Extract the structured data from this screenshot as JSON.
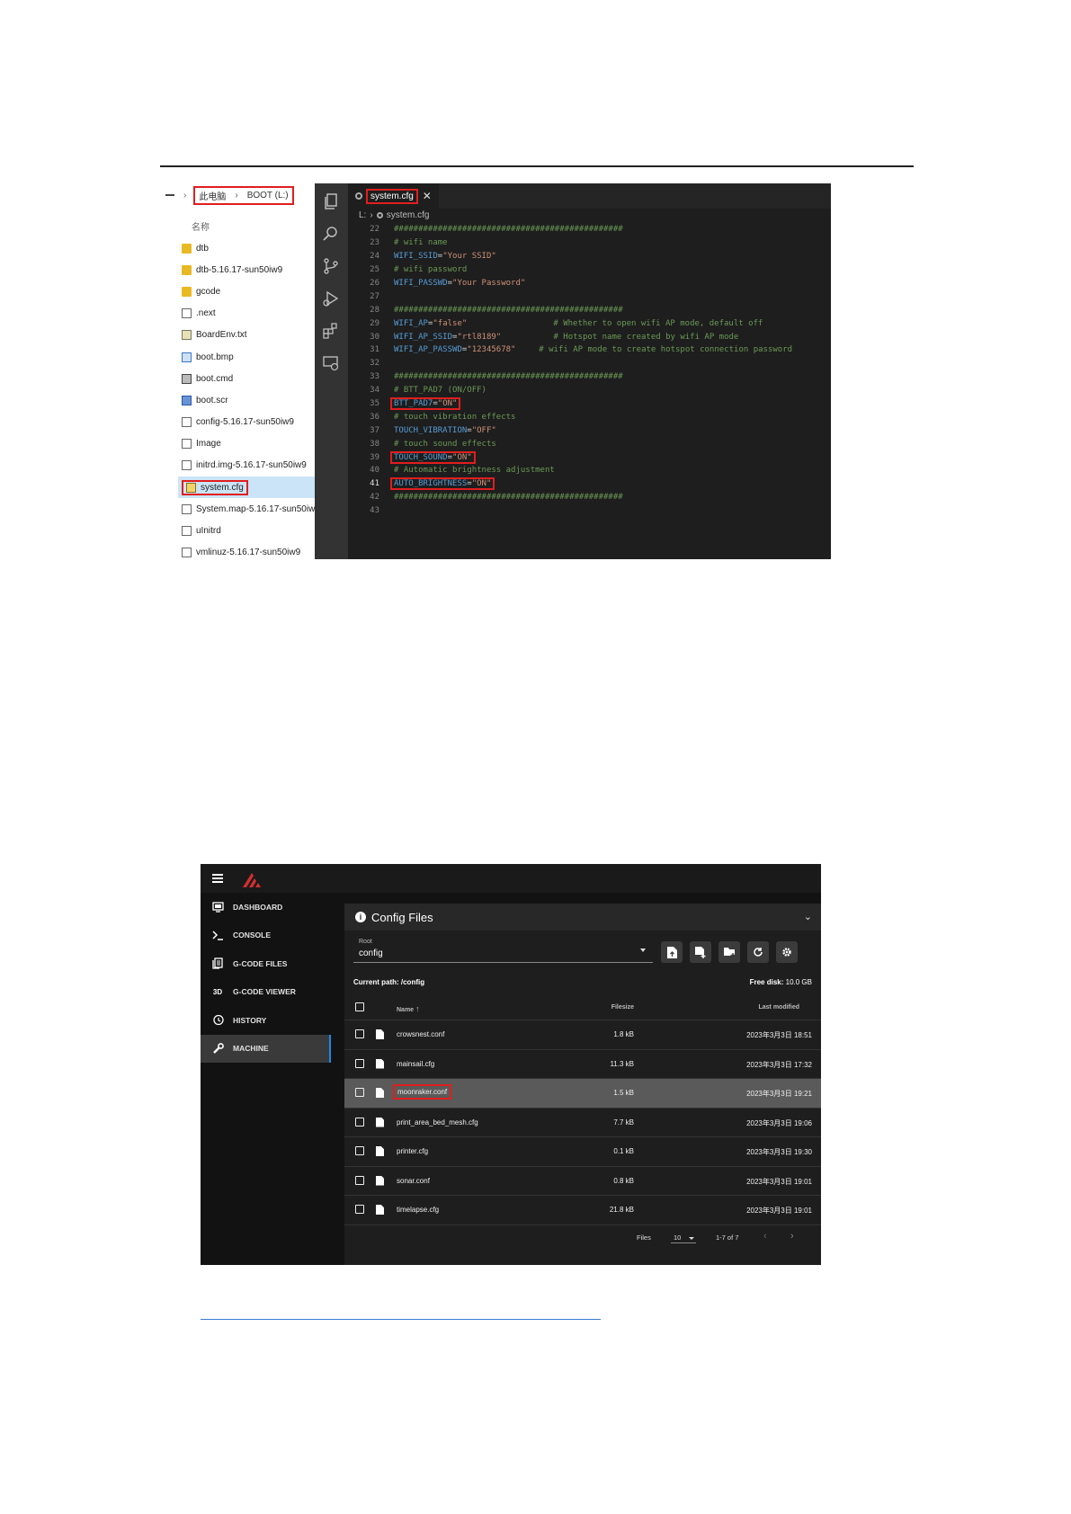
{
  "explorer": {
    "breadcrumb": [
      "此电脑",
      "BOOT (L:)"
    ],
    "column_header": "名称",
    "files": [
      {
        "name": "dtb",
        "icon": "folder-icon"
      },
      {
        "name": "dtb-5.16.17-sun50iw9",
        "icon": "folder-icon"
      },
      {
        "name": "gcode",
        "icon": "folder-icon"
      },
      {
        "name": ".next",
        "icon": "file-icon"
      },
      {
        "name": "BoardEnv.txt",
        "icon": "text-file-icon"
      },
      {
        "name": "boot.bmp",
        "icon": "image-file-icon"
      },
      {
        "name": "boot.cmd",
        "icon": "cmd-file-icon"
      },
      {
        "name": "boot.scr",
        "icon": "script-file-icon"
      },
      {
        "name": "config-5.16.17-sun50iw9",
        "icon": "file-icon"
      },
      {
        "name": "Image",
        "icon": "file-icon"
      },
      {
        "name": "initrd.img-5.16.17-sun50iw9",
        "icon": "file-icon"
      },
      {
        "name": "system.cfg",
        "icon": "config-file-icon"
      },
      {
        "name": "System.map-5.16.17-sun50iw9",
        "icon": "file-icon"
      },
      {
        "name": "uInitrd",
        "icon": "file-icon"
      },
      {
        "name": "vmlinuz-5.16.17-sun50iw9",
        "icon": "file-icon"
      }
    ]
  },
  "editor": {
    "tab_label": "system.cfg",
    "breadcrumb": [
      "L:",
      "system.cfg"
    ],
    "lines": [
      {
        "n": "22",
        "text": "###############################################"
      },
      {
        "n": "23",
        "text": "# wifi name"
      },
      {
        "n": "24",
        "key": "WIFI_SSID",
        "value": "\"Your SSID\""
      },
      {
        "n": "25",
        "text": "# wifi password"
      },
      {
        "n": "26",
        "key": "WIFI_PASSWD",
        "value": "\"Your Password\""
      },
      {
        "n": "27",
        "text": ""
      },
      {
        "n": "28",
        "text": "###############################################"
      },
      {
        "n": "29",
        "key": "WIFI_AP",
        "value": "\"false\"",
        "comment": "# Whether to open wifi AP mode, default off"
      },
      {
        "n": "30",
        "key": "WIFI_AP_SSID",
        "value": "\"rtl8189\"",
        "comment": "# Hotspot name created by wifi AP mode"
      },
      {
        "n": "31",
        "key": "WIFI_AP_PASSWD",
        "value": "\"12345678\"",
        "comment": "# wifi AP mode to create hotspot connection password"
      },
      {
        "n": "32",
        "text": ""
      },
      {
        "n": "33",
        "text": "###############################################"
      },
      {
        "n": "34",
        "text": "# BTT_PAD7 (ON/OFF)"
      },
      {
        "n": "35",
        "key": "BTT_PAD7",
        "value": "\"ON\""
      },
      {
        "n": "36",
        "text": "# touch vibration effects"
      },
      {
        "n": "37",
        "key": "TOUCH_VIBRATION",
        "value": "\"OFF\""
      },
      {
        "n": "38",
        "text": "# touch sound effects"
      },
      {
        "n": "39",
        "key": "TOUCH_SOUND",
        "value": "\"ON\""
      },
      {
        "n": "40",
        "text": "# Automatic brightness adjustment"
      },
      {
        "n": "41",
        "key": "AUTO_BRIGHTNESS",
        "value": "\"ON\""
      },
      {
        "n": "42",
        "text": "###############################################"
      },
      {
        "n": "43",
        "text": ""
      }
    ]
  },
  "mainsail": {
    "nav": [
      "DASHBOARD",
      "CONSOLE",
      "G-CODE FILES",
      "G-CODE VIEWER",
      "HISTORY",
      "MACHINE"
    ],
    "nav_icon_3d": "3D",
    "panel_title": "Config Files",
    "root_label": "Root",
    "root_value": "config",
    "current_path_label": "Current path: /config",
    "free_disk_label": "Free disk:",
    "free_disk_value": "10.0 GB",
    "columns": {
      "name": "Name",
      "filesize": "Filesize",
      "modified": "Last modified"
    },
    "files": [
      {
        "name": "crowsnest.conf",
        "size": "1.8 kB",
        "modified": "2023年3月3日 18:51"
      },
      {
        "name": "mainsail.cfg",
        "size": "11.3 kB",
        "modified": "2023年3月3日 17:32"
      },
      {
        "name": "moonraker.conf",
        "size": "1.5 kB",
        "modified": "2023年3月3日 19:21"
      },
      {
        "name": "print_area_bed_mesh.cfg",
        "size": "7.7 kB",
        "modified": "2023年3月3日 19:06"
      },
      {
        "name": "printer.cfg",
        "size": "0.1 kB",
        "modified": "2023年3月3日 19:30"
      },
      {
        "name": "sonar.conf",
        "size": "0.8 kB",
        "modified": "2023年3月3日 19:01"
      },
      {
        "name": "timelapse.cfg",
        "size": "21.8 kB",
        "modified": "2023年3月3日 19:01"
      }
    ],
    "pager": {
      "files_label": "Files",
      "per_page": "10",
      "range": "1-7 of 7"
    },
    "accent_color": "#1e88e5",
    "logo_color": "#d32f2f"
  },
  "highlight_color": "#e01e1e"
}
